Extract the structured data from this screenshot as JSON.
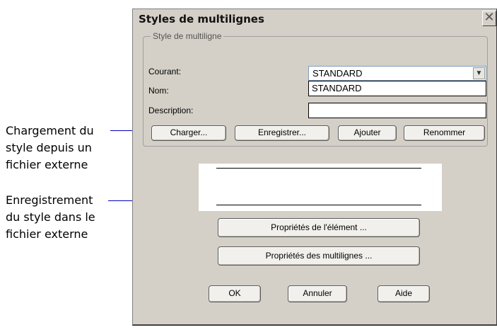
{
  "callouts": {
    "load": "Chargement du\nstyle depuis un\nfichier externe",
    "save": "Enregistrement\ndu style dans le\nfichier externe"
  },
  "dialog": {
    "title": "Styles de multilignes",
    "close_icon": "close-icon",
    "group_label": "Style de multiligne",
    "current_label": "Courant:",
    "current_value": "STANDARD",
    "name_label": "Nom:",
    "name_value": "STANDARD",
    "description_label": "Description:",
    "description_value": "",
    "buttons": {
      "load": "Charger...",
      "save": "Enregistrer...",
      "add": "Ajouter",
      "rename": "Renommer",
      "element_props": "Propriétés de l'élément ...",
      "multiline_props": "Propriétés des multilignes ...",
      "ok": "OK",
      "cancel": "Annuler",
      "help": "Aide"
    }
  }
}
